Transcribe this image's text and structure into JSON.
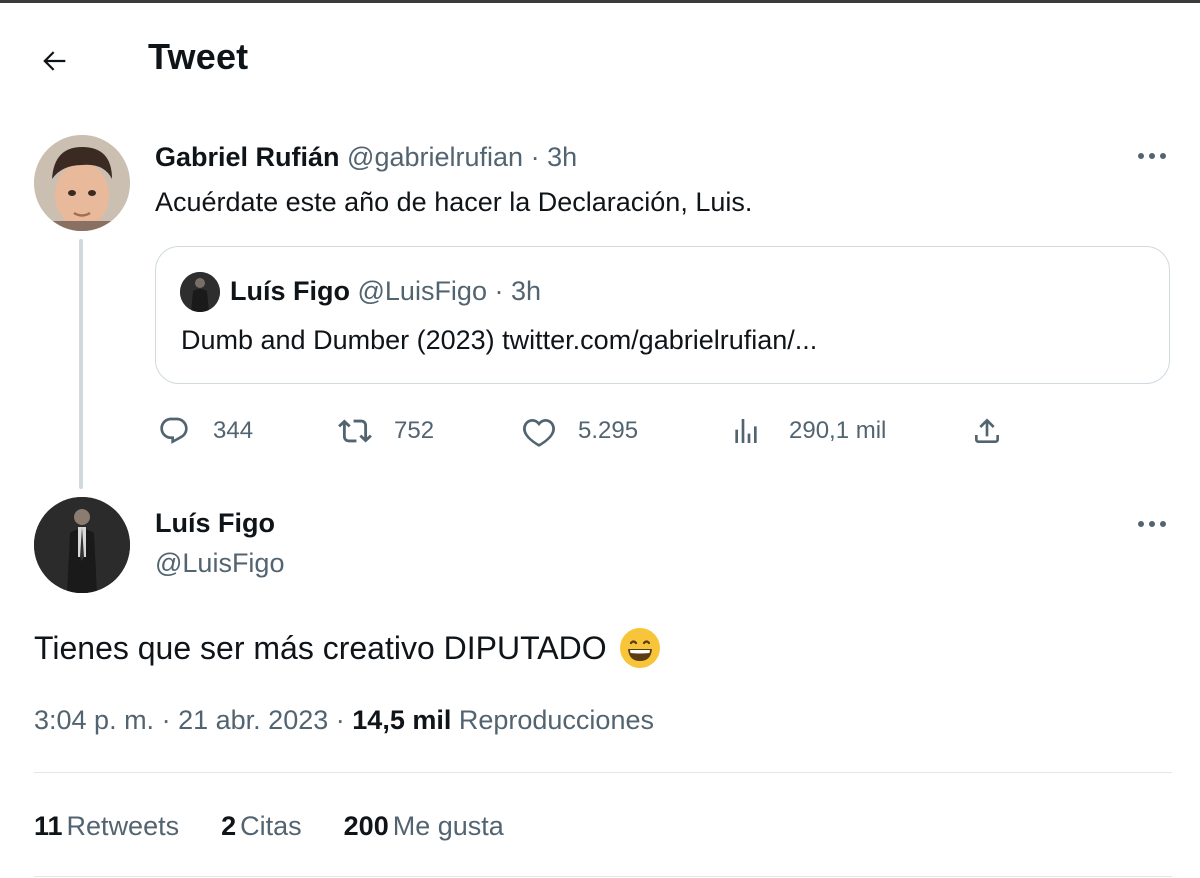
{
  "header": {
    "title": "Tweet",
    "back_icon": "arrow-left-icon"
  },
  "parent_tweet": {
    "author_name": "Gabriel Rufián",
    "handle": "@gabrielrufian",
    "separator": "·",
    "time": "3h",
    "text": "Acuérdate este año de hacer la Declaración, Luis.",
    "quote": {
      "author_name": "Luís Figo",
      "handle": "@LuisFigo",
      "separator": "·",
      "time": "3h",
      "text": "Dumb and Dumber (2023) twitter.com/gabrielrufian/..."
    },
    "actions": {
      "replies": "344",
      "retweets": "752",
      "likes": "5.295",
      "views": "290,1 mil"
    }
  },
  "main_tweet": {
    "author_name": "Luís Figo",
    "handle": "@LuisFigo",
    "text": "Tienes que ser más creativo DIPUTADO",
    "emoji": "grinning-face-icon",
    "time": "3:04 p. m.",
    "sep1": "·",
    "date": "21 abr. 2023",
    "sep2": "·",
    "views_count": "14,5 mil",
    "views_label": "Reproducciones",
    "stats": {
      "retweets_count": "11",
      "retweets_label": "Retweets",
      "quotes_count": "2",
      "quotes_label": "Citas",
      "likes_count": "200",
      "likes_label": "Me gusta"
    }
  },
  "colors": {
    "text": "#0f1419",
    "muted": "#536471",
    "border": "#cfd9de",
    "emoji": "#f7c43a"
  }
}
